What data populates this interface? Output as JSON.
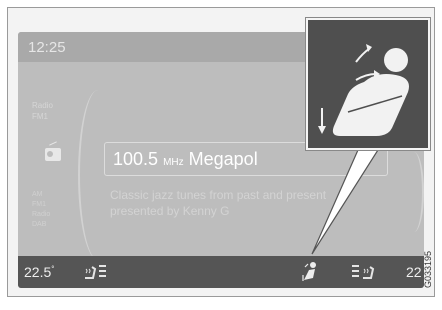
{
  "status_bar": {
    "time": "12:25"
  },
  "source": {
    "title": "Radio",
    "band": "FM1",
    "list": [
      "AM",
      "FM1",
      "Radio",
      "DAB"
    ]
  },
  "tuner": {
    "frequency": "100.5",
    "unit": "MHz",
    "station": "Megapol",
    "radiotext": "Classic jazz tunes from past and present presented by Kenny G"
  },
  "climate": {
    "temp_left": "22.5",
    "temp_left_unit": "°",
    "temp_right": "22"
  },
  "callout": {
    "icon": "seat-ventilation-icon"
  },
  "figure_code": "G033195",
  "colors": {
    "screen": "#bdbdbd",
    "climate_bar": "#555555",
    "callout": "#4f4f4f"
  }
}
